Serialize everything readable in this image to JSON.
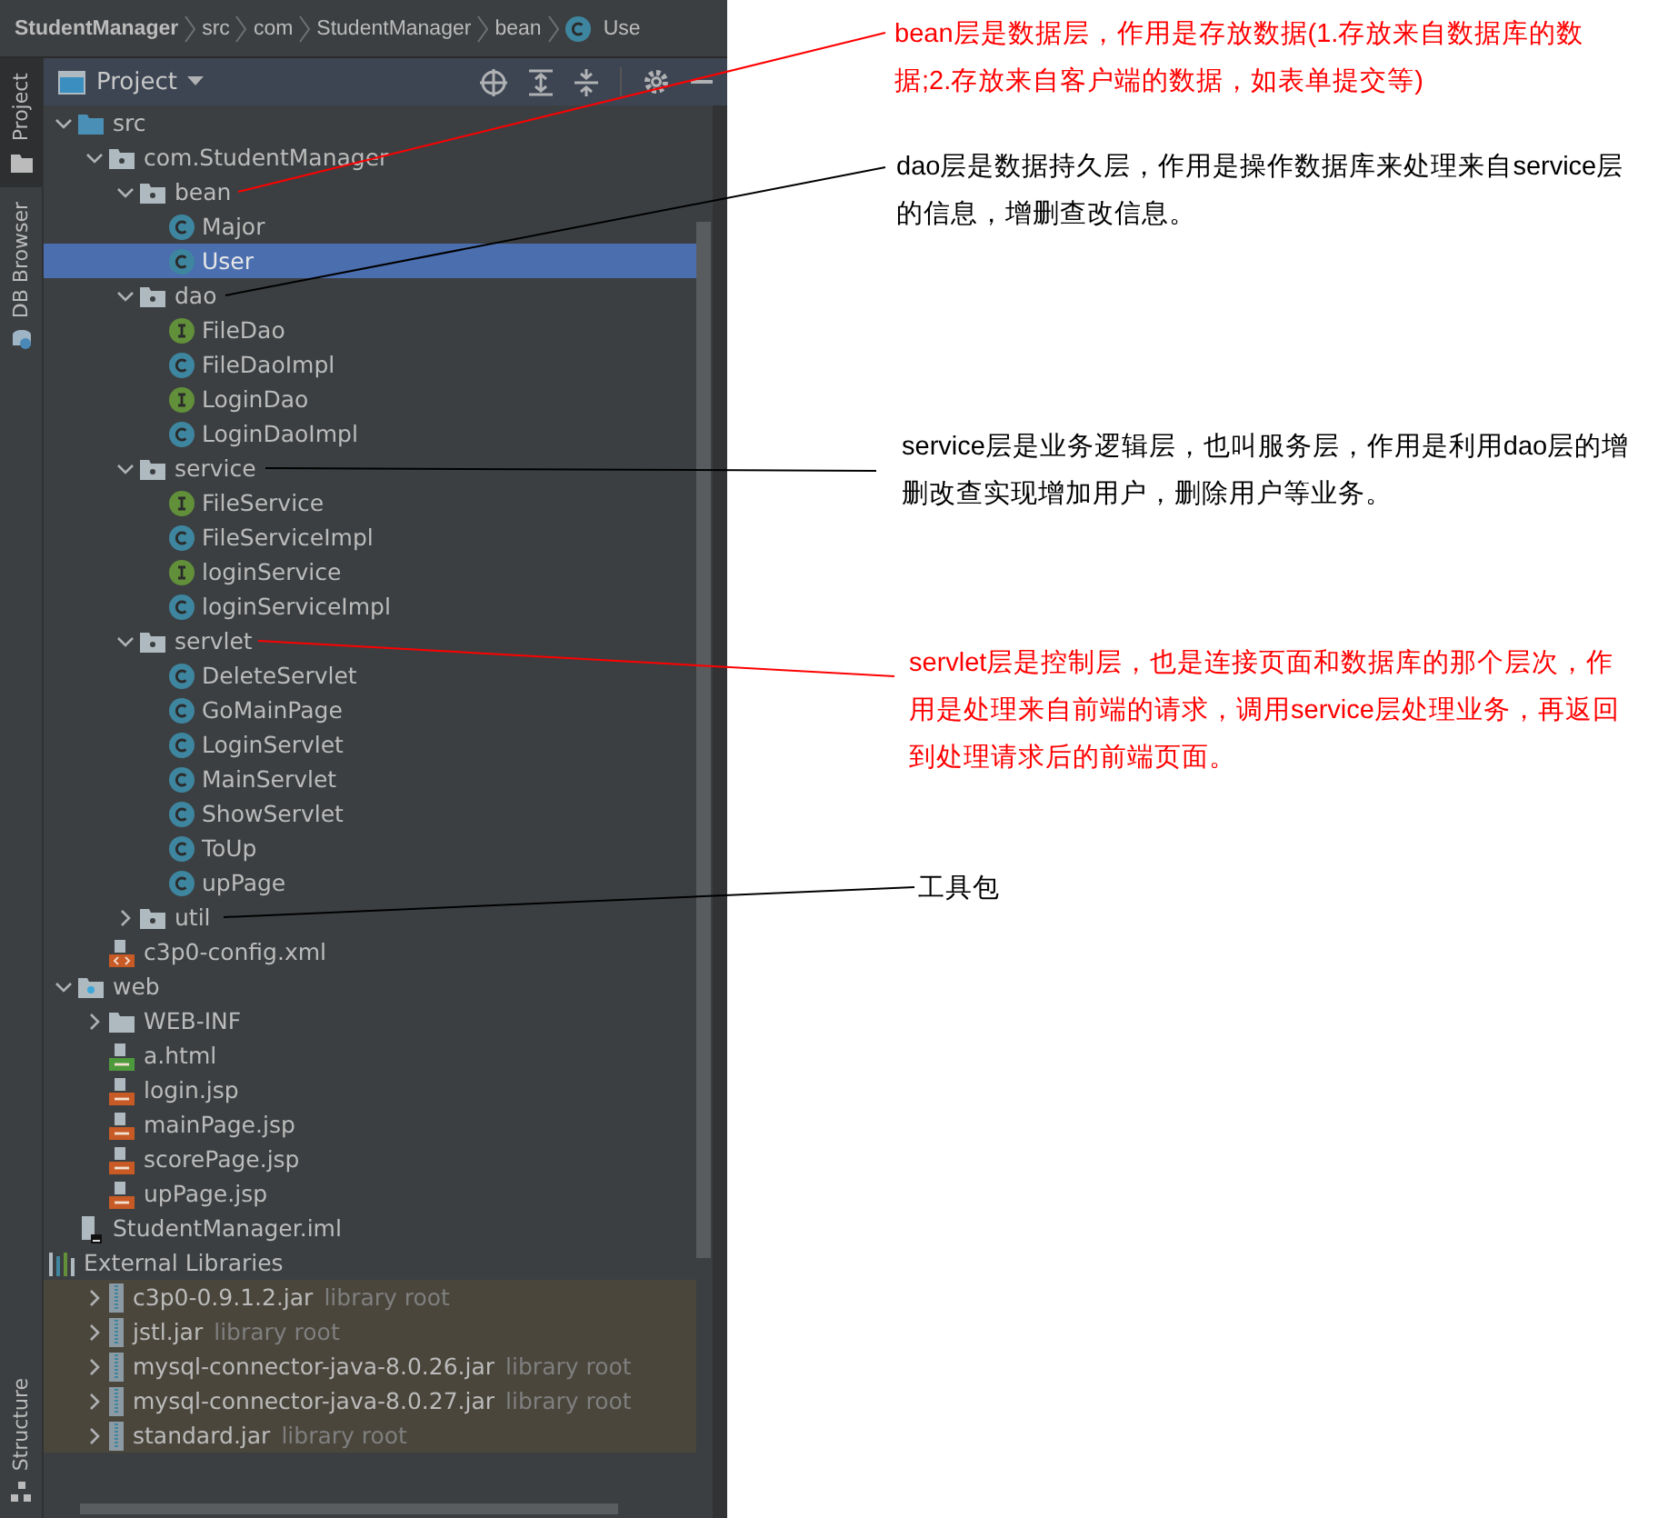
{
  "breadcrumb": [
    {
      "label": "StudentManager",
      "kind": "project"
    },
    {
      "label": "src",
      "kind": "folder"
    },
    {
      "label": "com",
      "kind": "folder"
    },
    {
      "label": "StudentManager",
      "kind": "folder"
    },
    {
      "label": "bean",
      "kind": "folder"
    },
    {
      "label": "Use",
      "kind": "class"
    }
  ],
  "side_tabs": [
    {
      "label": "Project",
      "selected": true
    },
    {
      "label": "DB Browser",
      "selected": false
    },
    {
      "label": "Structure",
      "selected": false
    }
  ],
  "panel": {
    "title": "Project"
  },
  "tree": [
    {
      "label": "src",
      "kind": "source",
      "expanded": true,
      "selected": false,
      "children": [
        {
          "label": "com.StudentManager",
          "kind": "package",
          "expanded": true,
          "selected": false,
          "children": [
            {
              "label": "bean",
              "kind": "package",
              "expanded": true,
              "selected": false,
              "children": [
                {
                  "label": "Major",
                  "kind": "class",
                  "selected": false
                },
                {
                  "label": "User",
                  "kind": "class",
                  "selected": true
                }
              ]
            },
            {
              "label": "dao",
              "kind": "package",
              "expanded": true,
              "selected": false,
              "children": [
                {
                  "label": "FileDao",
                  "kind": "interface",
                  "selected": false
                },
                {
                  "label": "FileDaoImpl",
                  "kind": "class",
                  "selected": false
                },
                {
                  "label": "LoginDao",
                  "kind": "interface",
                  "selected": false
                },
                {
                  "label": "LoginDaoImpl",
                  "kind": "class",
                  "selected": false
                }
              ]
            },
            {
              "label": "service",
              "kind": "package",
              "expanded": true,
              "selected": false,
              "children": [
                {
                  "label": "FileService",
                  "kind": "interface",
                  "selected": false
                },
                {
                  "label": "FileServiceImpl",
                  "kind": "class",
                  "selected": false
                },
                {
                  "label": "loginService",
                  "kind": "interface",
                  "selected": false
                },
                {
                  "label": "loginServiceImpl",
                  "kind": "class",
                  "selected": false
                }
              ]
            },
            {
              "label": "servlet",
              "kind": "package",
              "expanded": true,
              "selected": false,
              "children": [
                {
                  "label": "DeleteServlet",
                  "kind": "class",
                  "selected": false
                },
                {
                  "label": "GoMainPage",
                  "kind": "class",
                  "selected": false
                },
                {
                  "label": "LoginServlet",
                  "kind": "class",
                  "selected": false
                },
                {
                  "label": "MainServlet",
                  "kind": "class",
                  "selected": false
                },
                {
                  "label": "ShowServlet",
                  "kind": "class",
                  "selected": false
                },
                {
                  "label": "ToUp",
                  "kind": "class",
                  "selected": false
                },
                {
                  "label": "upPage",
                  "kind": "class",
                  "selected": false
                }
              ]
            },
            {
              "label": "util",
              "kind": "package",
              "expanded": false,
              "selected": false
            }
          ]
        },
        {
          "label": "c3p0-config.xml",
          "kind": "xml",
          "selected": false
        }
      ]
    },
    {
      "label": "web",
      "kind": "web",
      "expanded": true,
      "selected": false,
      "children": [
        {
          "label": "WEB-INF",
          "kind": "folder",
          "expanded": false,
          "selected": false
        },
        {
          "label": "a.html",
          "kind": "html",
          "selected": false
        },
        {
          "label": "login.jsp",
          "kind": "jsp",
          "selected": false
        },
        {
          "label": "mainPage.jsp",
          "kind": "jsp",
          "selected": false
        },
        {
          "label": "scorePage.jsp",
          "kind": "jsp",
          "selected": false
        },
        {
          "label": "upPage.jsp",
          "kind": "jsp",
          "selected": false
        }
      ]
    },
    {
      "label": "StudentManager.iml",
      "kind": "iml",
      "selected": false
    },
    {
      "label": "External Libraries",
      "kind": "libraries",
      "selected": false,
      "children": [
        {
          "label": "c3p0-0.9.1.2.jar",
          "hint": "library root",
          "kind": "jar",
          "expanded": false,
          "selected": false
        },
        {
          "label": "jstl.jar",
          "hint": "library root",
          "kind": "jar",
          "expanded": false,
          "selected": false
        },
        {
          "label": "mysql-connector-java-8.0.26.jar",
          "hint": "library root",
          "kind": "jar",
          "expanded": false,
          "selected": false
        },
        {
          "label": "mysql-connector-java-8.0.27.jar",
          "hint": "library root",
          "kind": "jar",
          "expanded": false,
          "selected": false
        },
        {
          "label": "standard.jar",
          "hint": "library root",
          "kind": "jar",
          "expanded": false,
          "selected": false
        }
      ]
    }
  ],
  "annotations": [
    {
      "text": "bean层是数据层，作用是存放数据(1.存放来自数据库的数据;2.存放来自客户端的数据，如表单提交等)",
      "color": "#ff0000"
    },
    {
      "text": "dao层是数据持久层，作用是操作数据库来处理来自service层的信息，增删查改信息。",
      "color": "#000000"
    },
    {
      "text": "service层是业务逻辑层，也叫服务层，作用是利用dao层的增删改查实现增加用户，删除用户等业务。",
      "color": "#000000"
    },
    {
      "text": "servlet层是控制层，也是连接页面和数据库的那个层次，作用是处理来自前端的请求，调用service层处理业务，再返回到处理请求后的前端页面。",
      "color": "#ff0000"
    },
    {
      "text": "工具包",
      "color": "#000000"
    }
  ]
}
